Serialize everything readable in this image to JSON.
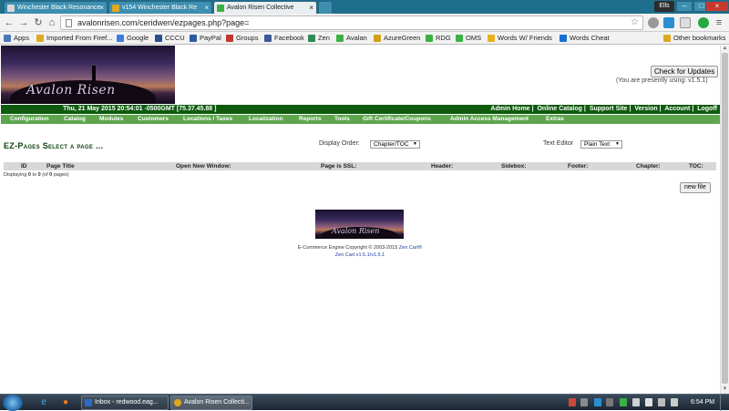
{
  "browser": {
    "tabs": [
      {
        "title": "Winchester Black Resonance",
        "active": false
      },
      {
        "title": "v154 Winchester Black Re",
        "active": false
      },
      {
        "title": "Avalon Risen Collective",
        "active": true
      }
    ],
    "user_badge": "Ells",
    "address": "avalonrisen.com/ceridwen/ezpages.php?page=",
    "bookmarks": [
      {
        "label": "Apps",
        "color": "#4a7ab8"
      },
      {
        "label": "Imported From Firef...",
        "color": "#e0a820"
      },
      {
        "label": "Google",
        "color": "#3f7de0"
      },
      {
        "label": "CCCU",
        "color": "#2a4f8a"
      },
      {
        "label": "PayPal",
        "color": "#2c5aa0"
      },
      {
        "label": "Groups",
        "color": "#c0392b"
      },
      {
        "label": "Facebook",
        "color": "#3b5998"
      },
      {
        "label": "Zen",
        "color": "#2e8b57"
      },
      {
        "label": "Avalan",
        "color": "#3cb043"
      },
      {
        "label": "AzureGreen",
        "color": "#d4a017"
      },
      {
        "label": "RDG",
        "color": "#3cb043"
      },
      {
        "label": "OMS",
        "color": "#3cb043"
      },
      {
        "label": "Words W/ Friends",
        "color": "#e8b020"
      },
      {
        "label": "Words Cheat",
        "color": "#1a6fd0"
      }
    ],
    "other_bookmarks": "Other bookmarks"
  },
  "header": {
    "logo_text": "Avalon Risen",
    "update_button": "Check for Updates",
    "version_note": "(You are presently using: v1.5.1)",
    "datetime": "Thu, 21 May 2015 20:54:01 -0500GMT [75.37.45.88 ]",
    "admin_links": [
      "Admin Home",
      "Online Catalog",
      "Support Site",
      "Version",
      "Account",
      "Logoff"
    ]
  },
  "menu": [
    "Configuration",
    "Catalog",
    "Modules",
    "Customers",
    "Locations / Taxes",
    "Localization",
    "Reports",
    "Tools",
    "Gift Certificate/Coupons",
    "Admin Access Management",
    "Extras"
  ],
  "main": {
    "heading": "EZ-Pages Select a page ...",
    "display_order_label": "Display Order:",
    "display_order_value": "Chapter/TOC",
    "text_editor_label": "Text Editor",
    "text_editor_value": "Plain Text",
    "columns": [
      "ID",
      "Page Title",
      "Open New Window:",
      "Page is SSL:",
      "Header:",
      "Sidebox:",
      "Footer:",
      "Chapter:",
      "TOC:"
    ],
    "displaying_prefix": "Displaying ",
    "displaying_from": "0",
    "displaying_mid": " to ",
    "displaying_to": "0",
    "displaying_suffix_a": " (of ",
    "displaying_total": "0",
    "displaying_suffix_b": " pages)",
    "new_file_button": "new file"
  },
  "footer": {
    "logo_text": "Avalon Risen",
    "copyright_line": "E-Commerce Engine Copyright © 2003-2015 ",
    "zencart_link": "Zen Cart®",
    "version_line": "Zen Cart v1.5.1/v1.5.1"
  },
  "taskbar": {
    "tasks": [
      {
        "title": "Inbox - redwood.eag...",
        "active": false,
        "color": "#2b6cc4"
      },
      {
        "title": "Avalon Risen Collecti...",
        "active": true,
        "color": "#e0a820"
      }
    ],
    "clock": "6:54 PM"
  }
}
